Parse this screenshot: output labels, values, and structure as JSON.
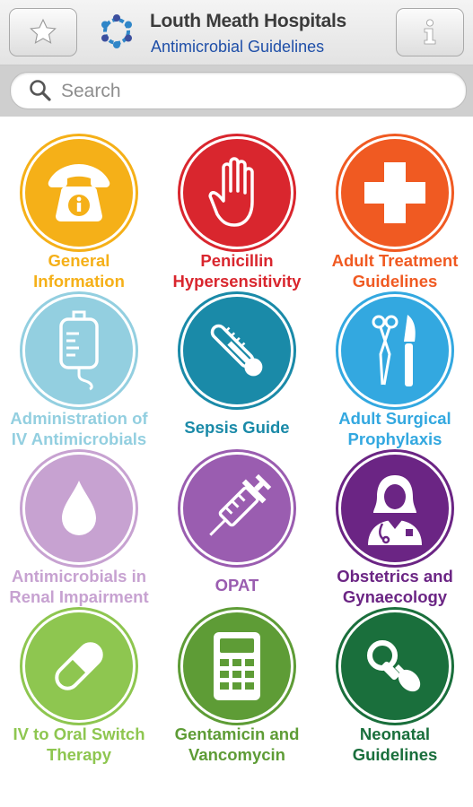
{
  "header": {
    "title": "Louth Meath Hospitals",
    "subtitle": "Antimicrobial Guidelines"
  },
  "search": {
    "placeholder": "Search"
  },
  "tiles": [
    {
      "label": "General\nInformation",
      "color": "#f5b018",
      "icon": "phone-info-icon"
    },
    {
      "label": "Penicillin\nHypersensitivity",
      "color": "#d9262e",
      "icon": "stop-hand-icon"
    },
    {
      "label": "Adult Treatment\nGuidelines",
      "color": "#f05a22",
      "icon": "medical-cross-icon"
    },
    {
      "label": "Administration of\nIV Antimicrobials",
      "color": "#93cfe0",
      "icon": "iv-bag-icon"
    },
    {
      "label": "Sepsis Guide",
      "color": "#1a8aa8",
      "icon": "thermometer-icon"
    },
    {
      "label": "Adult Surgical\nProphylaxis",
      "color": "#33a8e0",
      "icon": "surgical-tools-icon"
    },
    {
      "label": "Antimicrobials in\nRenal Impairment",
      "color": "#c7a2d1",
      "icon": "water-drop-icon"
    },
    {
      "label": "OPAT",
      "color": "#9a5db0",
      "icon": "syringe-icon"
    },
    {
      "label": "Obstetrics and\nGynaecology",
      "color": "#6b2584",
      "icon": "doctor-icon"
    },
    {
      "label": "IV to Oral Switch\nTherapy",
      "color": "#8ec650",
      "icon": "pill-icon"
    },
    {
      "label": "Gentamicin and\nVancomycin",
      "color": "#5e9c36",
      "icon": "calculator-icon"
    },
    {
      "label": "Neonatal\nGuidelines",
      "color": "#1a6f3c",
      "icon": "pacifier-icon"
    }
  ]
}
